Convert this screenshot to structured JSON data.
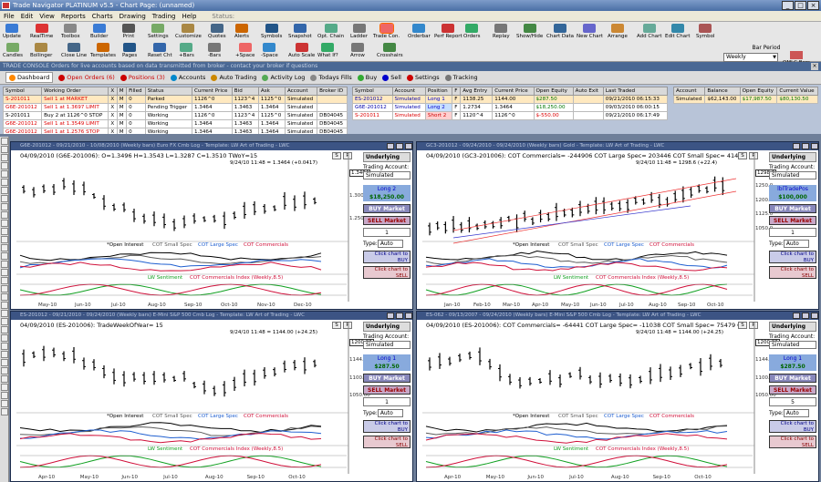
{
  "window": {
    "title": "Trade Navigator PLATINUM v5.5 - Chart Page: (unnamed)"
  },
  "menu": [
    "File",
    "Edit",
    "View",
    "Reports",
    "Charts",
    "Drawing",
    "Trading",
    "Help"
  ],
  "menu_status": "Status:",
  "toolbar": {
    "buttons": [
      "Update",
      "RealTime",
      "Toolbox",
      "Builder",
      "Print",
      "Settings",
      "Customize",
      "Quotes",
      "Alerts",
      "Symbols",
      "Snapshot",
      "Opt. Chain",
      "Ladder",
      "Trade Con.",
      "Orderbar",
      "Perf Report",
      "Orders",
      "Replay",
      "Show/Hide",
      "Chart Data",
      "New Chart",
      "Arrange",
      "Add Chart",
      "Edit Chart",
      "Symbol"
    ],
    "row2": [
      "Candles",
      "Bollinger",
      "Close Line",
      "Templates",
      "Pages",
      "Reset Cht",
      "+Bars",
      "-Bars",
      "+Space",
      "-Space",
      "Auto Scale",
      "What If?",
      "Arrow",
      "Crosshairs"
    ],
    "bar_period_label": "Bar Period",
    "bar_period_value": "Weekly",
    "omlc": "OMLC Bars"
  },
  "console": {
    "title": "TRADE CONSOLE  Orders for live accounts based on data transmitted from broker - contact your broker if questions",
    "tabs": [
      "Dashboard",
      "Open Orders (6)",
      "Positions (3)",
      "Accounts",
      "Auto Trading",
      "Activity Log",
      "Todays Fills",
      "Buy",
      "Sell",
      "Settings",
      "Tracking"
    ],
    "orders": {
      "headers": [
        "Symbol",
        "Working Order",
        "X",
        "M",
        "Filled",
        "Status",
        "Current Price",
        "Bid",
        "Ask",
        "Account",
        "Broker ID"
      ],
      "rows": [
        [
          "S-201011",
          "Sell 1 at MARKET",
          "X",
          "M",
          "0",
          "Parked",
          "1126^0",
          "1123^4",
          "1125^0",
          "Simulated",
          ""
        ],
        [
          "G6E-201012",
          "Sell 1 at 1.3697 LIMIT",
          "X",
          "M",
          "0",
          "Pending Trigger",
          "1.3464",
          "1.3463",
          "1.3464",
          "Simulated",
          ""
        ],
        [
          "S-201011",
          "Buy 2 at 1126^0 STOP",
          "X",
          "M",
          "0",
          "Working",
          "1126^0",
          "1123^4",
          "1125^0",
          "Simulated",
          "DB04045"
        ],
        [
          "G6E-201012",
          "Sell 1 at 1.3549 LIMIT",
          "X",
          "M",
          "0",
          "Working",
          "1.3464",
          "1.3463",
          "1.3464",
          "Simulated",
          "DB04045"
        ],
        [
          "G6E-201012",
          "Sell 1 at 1.2576 STOP",
          "X",
          "M",
          "0",
          "Working",
          "1.3464",
          "1.3463",
          "1.3464",
          "Simulated",
          "DB04045"
        ]
      ]
    },
    "positions": {
      "headers": [
        "Symbol",
        "Account",
        "Position",
        "F",
        "Avg Entry",
        "Current Price",
        "Open Equity",
        "Auto Exit",
        "Last Traded"
      ],
      "rows": [
        [
          "ES-201012",
          "Simulated",
          "Long 1",
          "F",
          "1138.25",
          "1144.00",
          "$287.50",
          "",
          "09/21/2010 06:15:33"
        ],
        [
          "G6E-201012",
          "Simulated",
          "Long 2",
          "F",
          "1.2734",
          "1.3464",
          "$18,250.00",
          "",
          "09/03/2010 06:00:15"
        ],
        [
          "S-201011",
          "Simulated",
          "Short 2",
          "F",
          "1120^4",
          "1126^0",
          "$-550.00",
          "",
          "09/21/2010 06:17:49"
        ]
      ]
    },
    "accounts": {
      "headers": [
        "Account",
        "Balance",
        "Open Equity",
        "Current Value"
      ],
      "rows": [
        [
          "Simulated",
          "$62,143.00",
          "$17,987.50",
          "$80,130.50"
        ]
      ]
    }
  },
  "charts": [
    {
      "id": "c1",
      "header": "G6E-201012 - 09/21/2010 - 10/08/2010 (Weekly bars) Euro FX Cmb Log - Template: LW Art of Trading - LWC",
      "title": "04/09/2010 (G6E-201006): O=1.3496  H=1.3543  L=1.3287  C=1.3510  TWoY=15",
      "info": "9/24/10 11:48 = 1.3464 (+0.0417)",
      "legend1": [
        "*Open Interest",
        "COT Small Spec",
        "COT Large Spec",
        "COT Commercials"
      ],
      "legend2": [
        "LW Sentiment",
        "COT Commercials Index (Weekly,8.5)"
      ],
      "xticks": [
        "May-10",
        "Jun-10",
        "Jul-10",
        "Aug-10",
        "Sep-10",
        "Oct-10",
        "Nov-10",
        "Dec-10"
      ],
      "yticks": [
        "1.3464",
        "1.3000",
        "1.2500"
      ],
      "side": {
        "position": "Long 2",
        "pl": "$18,250.00",
        "qty": "1",
        "type": "Auto"
      }
    },
    {
      "id": "c2",
      "header": "GC3-201012 - 09/24/2010 - 09/24/2010 (Weekly bars) Gold - Template: LW Art of Trading - LWC",
      "title": "04/09/2010 (GC3-201006):  COT Commercials= -244906   COT Large Spec= 203446   COT Small Spec= 41460  Open",
      "info": "9/24/10 11:48 = 1298.6 (+22.4)",
      "legend1": [
        "*Open Interest",
        "COT Small Spec",
        "COT Large Spec",
        "COT Commercials"
      ],
      "legend2": [
        "LW Sentiment",
        "COT Commercials Index (Weekly,8.5)"
      ],
      "xticks": [
        "Jan-10",
        "Feb-10",
        "Mar-10",
        "Apr-10",
        "May-10",
        "Jun-10",
        "Jul-10",
        "Aug-10",
        "Sep-10",
        "Oct-10"
      ],
      "yticks": [
        "1298.6",
        "1250.0",
        "1200.0",
        "1125.0",
        "1050.0"
      ],
      "side": {
        "position": "lblTradePos",
        "pl": "$100,000",
        "qty": "1",
        "type": "Auto"
      }
    },
    {
      "id": "c3",
      "header": "ES-201012 - 09/21/2010 - 09/24/2010 (Weekly bars) E-Mini S&P 500 Cmb Log - Template: LW Art of Trading - LWC",
      "title": "04/09/2010 (ES-201006):  TradeWeekOfYear= 15",
      "info": "9/24/10 11:48 = 1144.00 (+24.25)",
      "legend1": [
        "*Open Interest",
        "COT Small Spec",
        "COT Large Spec",
        "COT Commercials"
      ],
      "legend2": [
        "LW Sentiment",
        "COT Commercials Index (Weekly,8.5)"
      ],
      "xticks": [
        "Apr-10",
        "May-10",
        "Jun-10",
        "Jul-10",
        "Aug-10",
        "Sep-10",
        "Oct-10"
      ],
      "yticks": [
        "1200.00",
        "1144.00",
        "1100.00",
        "1050.00"
      ],
      "side": {
        "position": "Long 1",
        "pl": "$287.50",
        "qty": "1",
        "type": "Auto"
      }
    },
    {
      "id": "c4",
      "header": "ES-062 - 09/13/2007 - 09/24/2010 (Weekly bars) E-Mini S&P 500 Cmb Log - Template: LW Art of Trading - LWC",
      "title": "04/09/2010 (ES-201006):  COT Commercials= -64441   COT Large Spec= -11038   COT Small Spec= 75479  Open",
      "info": "9/24/10 11:48 = 1144.00 (+24.25)",
      "legend1": [
        "*Open Interest",
        "COT Small Spec",
        "COT Large Spec",
        "COT Commercials"
      ],
      "legend2": [
        "LW Sentiment",
        "COT Commercials Index (Weekly,8.5)"
      ],
      "xticks": [
        "Apr-10",
        "May-10",
        "Jun-10",
        "Jul-10",
        "Aug-10",
        "Sep-10",
        "Oct-10"
      ],
      "yticks": [
        "1200.00",
        "1144.00",
        "1100.00",
        "1050.00"
      ],
      "side": {
        "position": "Long 1",
        "pl": "$287.50",
        "qty": "5",
        "type": "Auto"
      }
    }
  ],
  "side_labels": {
    "underlying": "Underlying",
    "trading_account": "Trading Account:",
    "account": "Simulated",
    "buy": "BUY Market",
    "sell": "SELL Market",
    "type_label": "Type:",
    "click_buy": "Click chart to BUY",
    "click_sell": "Click chart to SELL"
  },
  "colors": {
    "title_bar": "#4a6fa5",
    "chart_header": "#3c5484",
    "open_interest": "#000000",
    "small_spec": "#5a5a5a",
    "large_spec": "#1f5fd0",
    "commercials": "#d0103a",
    "sentiment": "#10a020"
  }
}
